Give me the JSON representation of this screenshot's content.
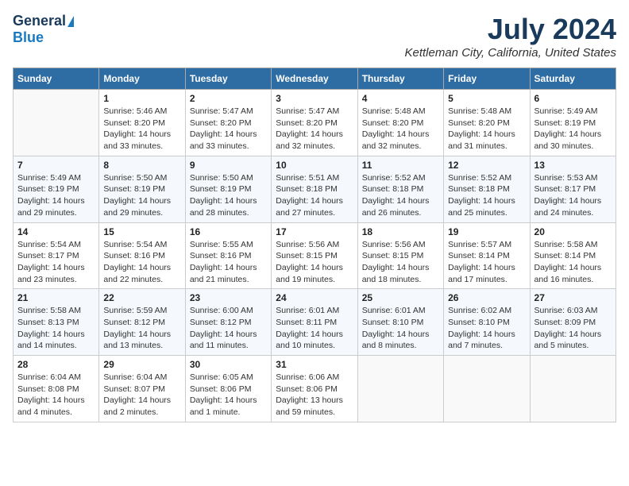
{
  "logo": {
    "general": "General",
    "blue": "Blue"
  },
  "title": "July 2024",
  "subtitle": "Kettleman City, California, United States",
  "weekdays": [
    "Sunday",
    "Monday",
    "Tuesday",
    "Wednesday",
    "Thursday",
    "Friday",
    "Saturday"
  ],
  "weeks": [
    [
      {
        "day": "",
        "info": ""
      },
      {
        "day": "1",
        "info": "Sunrise: 5:46 AM\nSunset: 8:20 PM\nDaylight: 14 hours\nand 33 minutes."
      },
      {
        "day": "2",
        "info": "Sunrise: 5:47 AM\nSunset: 8:20 PM\nDaylight: 14 hours\nand 33 minutes."
      },
      {
        "day": "3",
        "info": "Sunrise: 5:47 AM\nSunset: 8:20 PM\nDaylight: 14 hours\nand 32 minutes."
      },
      {
        "day": "4",
        "info": "Sunrise: 5:48 AM\nSunset: 8:20 PM\nDaylight: 14 hours\nand 32 minutes."
      },
      {
        "day": "5",
        "info": "Sunrise: 5:48 AM\nSunset: 8:20 PM\nDaylight: 14 hours\nand 31 minutes."
      },
      {
        "day": "6",
        "info": "Sunrise: 5:49 AM\nSunset: 8:19 PM\nDaylight: 14 hours\nand 30 minutes."
      }
    ],
    [
      {
        "day": "7",
        "info": "Sunrise: 5:49 AM\nSunset: 8:19 PM\nDaylight: 14 hours\nand 29 minutes."
      },
      {
        "day": "8",
        "info": "Sunrise: 5:50 AM\nSunset: 8:19 PM\nDaylight: 14 hours\nand 29 minutes."
      },
      {
        "day": "9",
        "info": "Sunrise: 5:50 AM\nSunset: 8:19 PM\nDaylight: 14 hours\nand 28 minutes."
      },
      {
        "day": "10",
        "info": "Sunrise: 5:51 AM\nSunset: 8:18 PM\nDaylight: 14 hours\nand 27 minutes."
      },
      {
        "day": "11",
        "info": "Sunrise: 5:52 AM\nSunset: 8:18 PM\nDaylight: 14 hours\nand 26 minutes."
      },
      {
        "day": "12",
        "info": "Sunrise: 5:52 AM\nSunset: 8:18 PM\nDaylight: 14 hours\nand 25 minutes."
      },
      {
        "day": "13",
        "info": "Sunrise: 5:53 AM\nSunset: 8:17 PM\nDaylight: 14 hours\nand 24 minutes."
      }
    ],
    [
      {
        "day": "14",
        "info": "Sunrise: 5:54 AM\nSunset: 8:17 PM\nDaylight: 14 hours\nand 23 minutes."
      },
      {
        "day": "15",
        "info": "Sunrise: 5:54 AM\nSunset: 8:16 PM\nDaylight: 14 hours\nand 22 minutes."
      },
      {
        "day": "16",
        "info": "Sunrise: 5:55 AM\nSunset: 8:16 PM\nDaylight: 14 hours\nand 21 minutes."
      },
      {
        "day": "17",
        "info": "Sunrise: 5:56 AM\nSunset: 8:15 PM\nDaylight: 14 hours\nand 19 minutes."
      },
      {
        "day": "18",
        "info": "Sunrise: 5:56 AM\nSunset: 8:15 PM\nDaylight: 14 hours\nand 18 minutes."
      },
      {
        "day": "19",
        "info": "Sunrise: 5:57 AM\nSunset: 8:14 PM\nDaylight: 14 hours\nand 17 minutes."
      },
      {
        "day": "20",
        "info": "Sunrise: 5:58 AM\nSunset: 8:14 PM\nDaylight: 14 hours\nand 16 minutes."
      }
    ],
    [
      {
        "day": "21",
        "info": "Sunrise: 5:58 AM\nSunset: 8:13 PM\nDaylight: 14 hours\nand 14 minutes."
      },
      {
        "day": "22",
        "info": "Sunrise: 5:59 AM\nSunset: 8:12 PM\nDaylight: 14 hours\nand 13 minutes."
      },
      {
        "day": "23",
        "info": "Sunrise: 6:00 AM\nSunset: 8:12 PM\nDaylight: 14 hours\nand 11 minutes."
      },
      {
        "day": "24",
        "info": "Sunrise: 6:01 AM\nSunset: 8:11 PM\nDaylight: 14 hours\nand 10 minutes."
      },
      {
        "day": "25",
        "info": "Sunrise: 6:01 AM\nSunset: 8:10 PM\nDaylight: 14 hours\nand 8 minutes."
      },
      {
        "day": "26",
        "info": "Sunrise: 6:02 AM\nSunset: 8:10 PM\nDaylight: 14 hours\nand 7 minutes."
      },
      {
        "day": "27",
        "info": "Sunrise: 6:03 AM\nSunset: 8:09 PM\nDaylight: 14 hours\nand 5 minutes."
      }
    ],
    [
      {
        "day": "28",
        "info": "Sunrise: 6:04 AM\nSunset: 8:08 PM\nDaylight: 14 hours\nand 4 minutes."
      },
      {
        "day": "29",
        "info": "Sunrise: 6:04 AM\nSunset: 8:07 PM\nDaylight: 14 hours\nand 2 minutes."
      },
      {
        "day": "30",
        "info": "Sunrise: 6:05 AM\nSunset: 8:06 PM\nDaylight: 14 hours\nand 1 minute."
      },
      {
        "day": "31",
        "info": "Sunrise: 6:06 AM\nSunset: 8:06 PM\nDaylight: 13 hours\nand 59 minutes."
      },
      {
        "day": "",
        "info": ""
      },
      {
        "day": "",
        "info": ""
      },
      {
        "day": "",
        "info": ""
      }
    ]
  ]
}
